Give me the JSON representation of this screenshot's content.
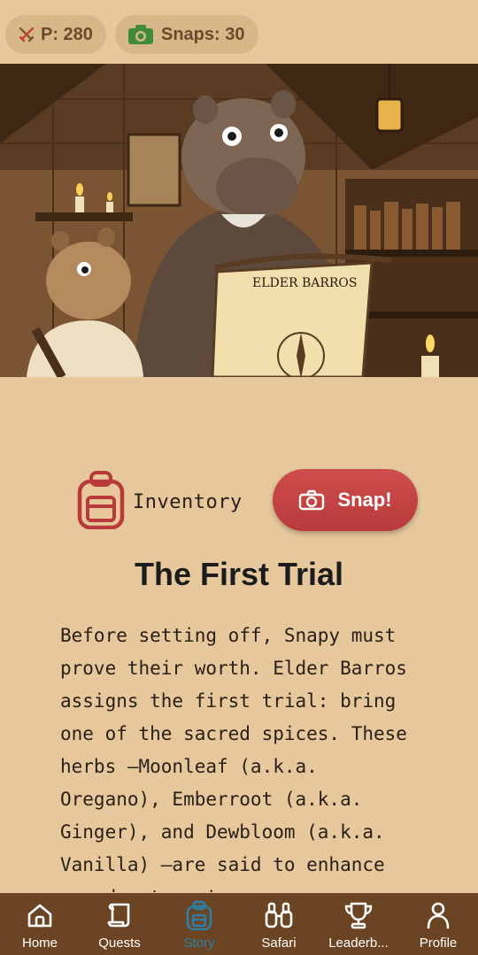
{
  "status": {
    "points_label": "P: 280",
    "snaps_label": "Snaps: 30"
  },
  "hero": {
    "scroll_text": "ELDER BARROS"
  },
  "actions": {
    "inventory_label": "Inventory",
    "snap_label": "Snap!"
  },
  "chapter": {
    "title": "The First Trial",
    "body": "Before setting off, Snapy must prove their worth. Elder Barros assigns the first trial: bring one of the sacred spices. These herbs —Moonleaf (a.k.a. Oregano), Emberroot (a.k.a. Ginger), and Dewbloom (a.k.a. Vanilla) —are said to enhance an adventurer's"
  },
  "nav": {
    "items": [
      {
        "label": "Home",
        "icon": "home-icon"
      },
      {
        "label": "Quests",
        "icon": "scroll-icon"
      },
      {
        "label": "Story",
        "icon": "backpack-icon"
      },
      {
        "label": "Safari",
        "icon": "binoculars-icon"
      },
      {
        "label": "Leaderb...",
        "icon": "trophy-icon"
      },
      {
        "label": "Profile",
        "icon": "person-icon"
      }
    ],
    "active": "Story"
  },
  "colors": {
    "background": "#e6c89c",
    "pill": "#d6b888",
    "snap_button": "#c24444",
    "inventory_icon": "#b83a3a",
    "nav_bar": "#6b4523",
    "nav_active": "#2c7fa6"
  }
}
